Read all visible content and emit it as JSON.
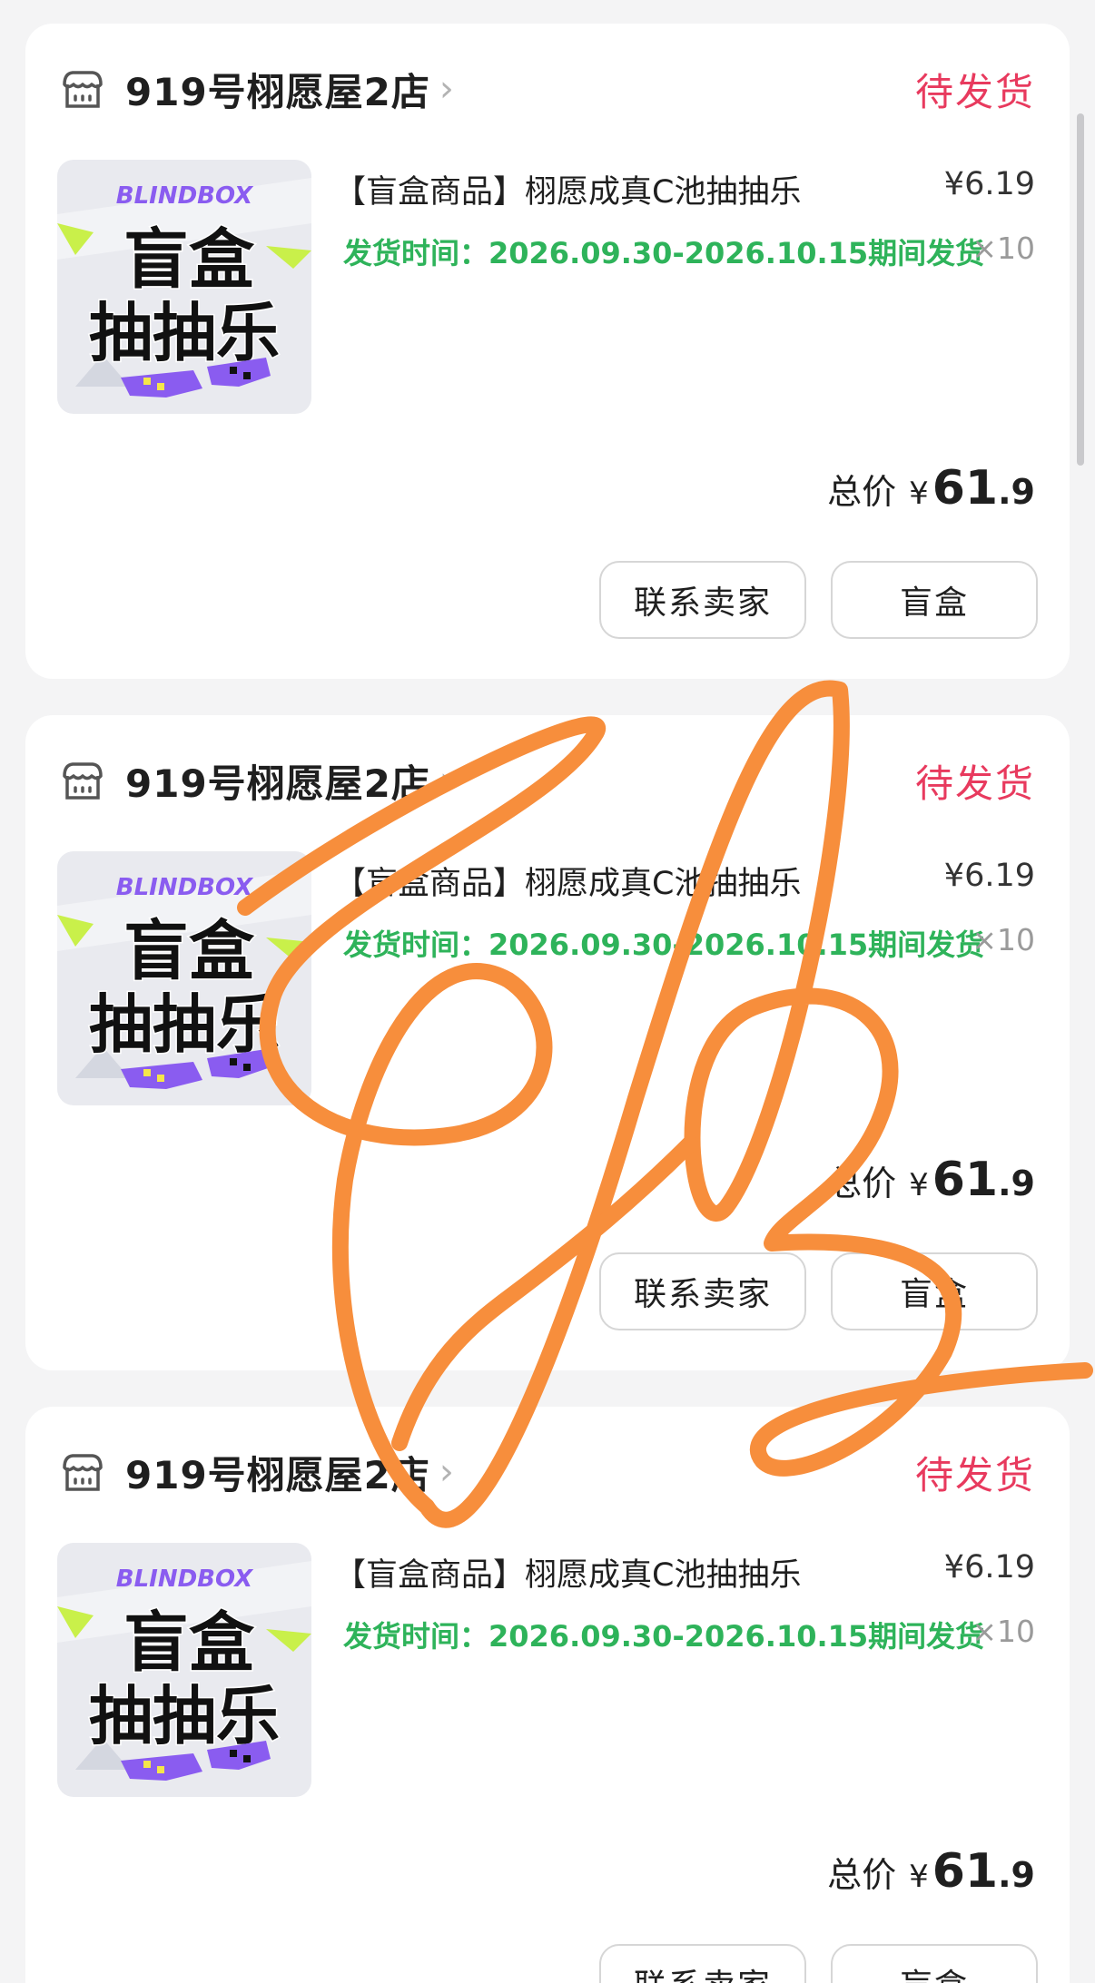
{
  "colors": {
    "status": "#e83a5e",
    "shipping": "#2eb35a",
    "scribble": "#f78e3c"
  },
  "orders": [
    {
      "shop_name": "919号栩愿屋2店",
      "status": "待发货",
      "product_image_text": {
        "brand": "BLINDBOX",
        "line1": "盲盒",
        "line2": "抽抽乐"
      },
      "title": "【盲盒商品】栩愿成真C池抽抽乐",
      "unit_price": "¥6.19",
      "shipping_info": "发货时间：2026.09.30-2026.10.15期间发货",
      "quantity": "×10",
      "total_label": "总价",
      "total_currency": "¥",
      "total_int": "61",
      "total_dec": ".9",
      "buttons": {
        "contact": "联系卖家",
        "box": "盲盒"
      }
    },
    {
      "shop_name": "919号栩愿屋2店",
      "status": "待发货",
      "product_image_text": {
        "brand": "BLINDBOX",
        "line1": "盲盒",
        "line2": "抽抽乐"
      },
      "title": "【盲盒商品】栩愿成真C池抽抽乐",
      "unit_price": "¥6.19",
      "shipping_info": "发货时间：2026.09.30-2026.10.15期间发货",
      "quantity": "×10",
      "total_label": "总价",
      "total_currency": "¥",
      "total_int": "61",
      "total_dec": ".9",
      "buttons": {
        "contact": "联系卖家",
        "box": "盲盒"
      }
    },
    {
      "shop_name": "919号栩愿屋2店",
      "status": "待发货",
      "product_image_text": {
        "brand": "BLINDBOX",
        "line1": "盲盒",
        "line2": "抽抽乐"
      },
      "title": "【盲盒商品】栩愿成真C池抽抽乐",
      "unit_price": "¥6.19",
      "shipping_info": "发货时间：2026.09.30-2026.10.15期间发货",
      "quantity": "×10",
      "total_label": "总价",
      "total_currency": "¥",
      "total_int": "61",
      "total_dec": ".9",
      "buttons": {
        "contact": "联系卖家",
        "box": "盲盒"
      }
    }
  ]
}
